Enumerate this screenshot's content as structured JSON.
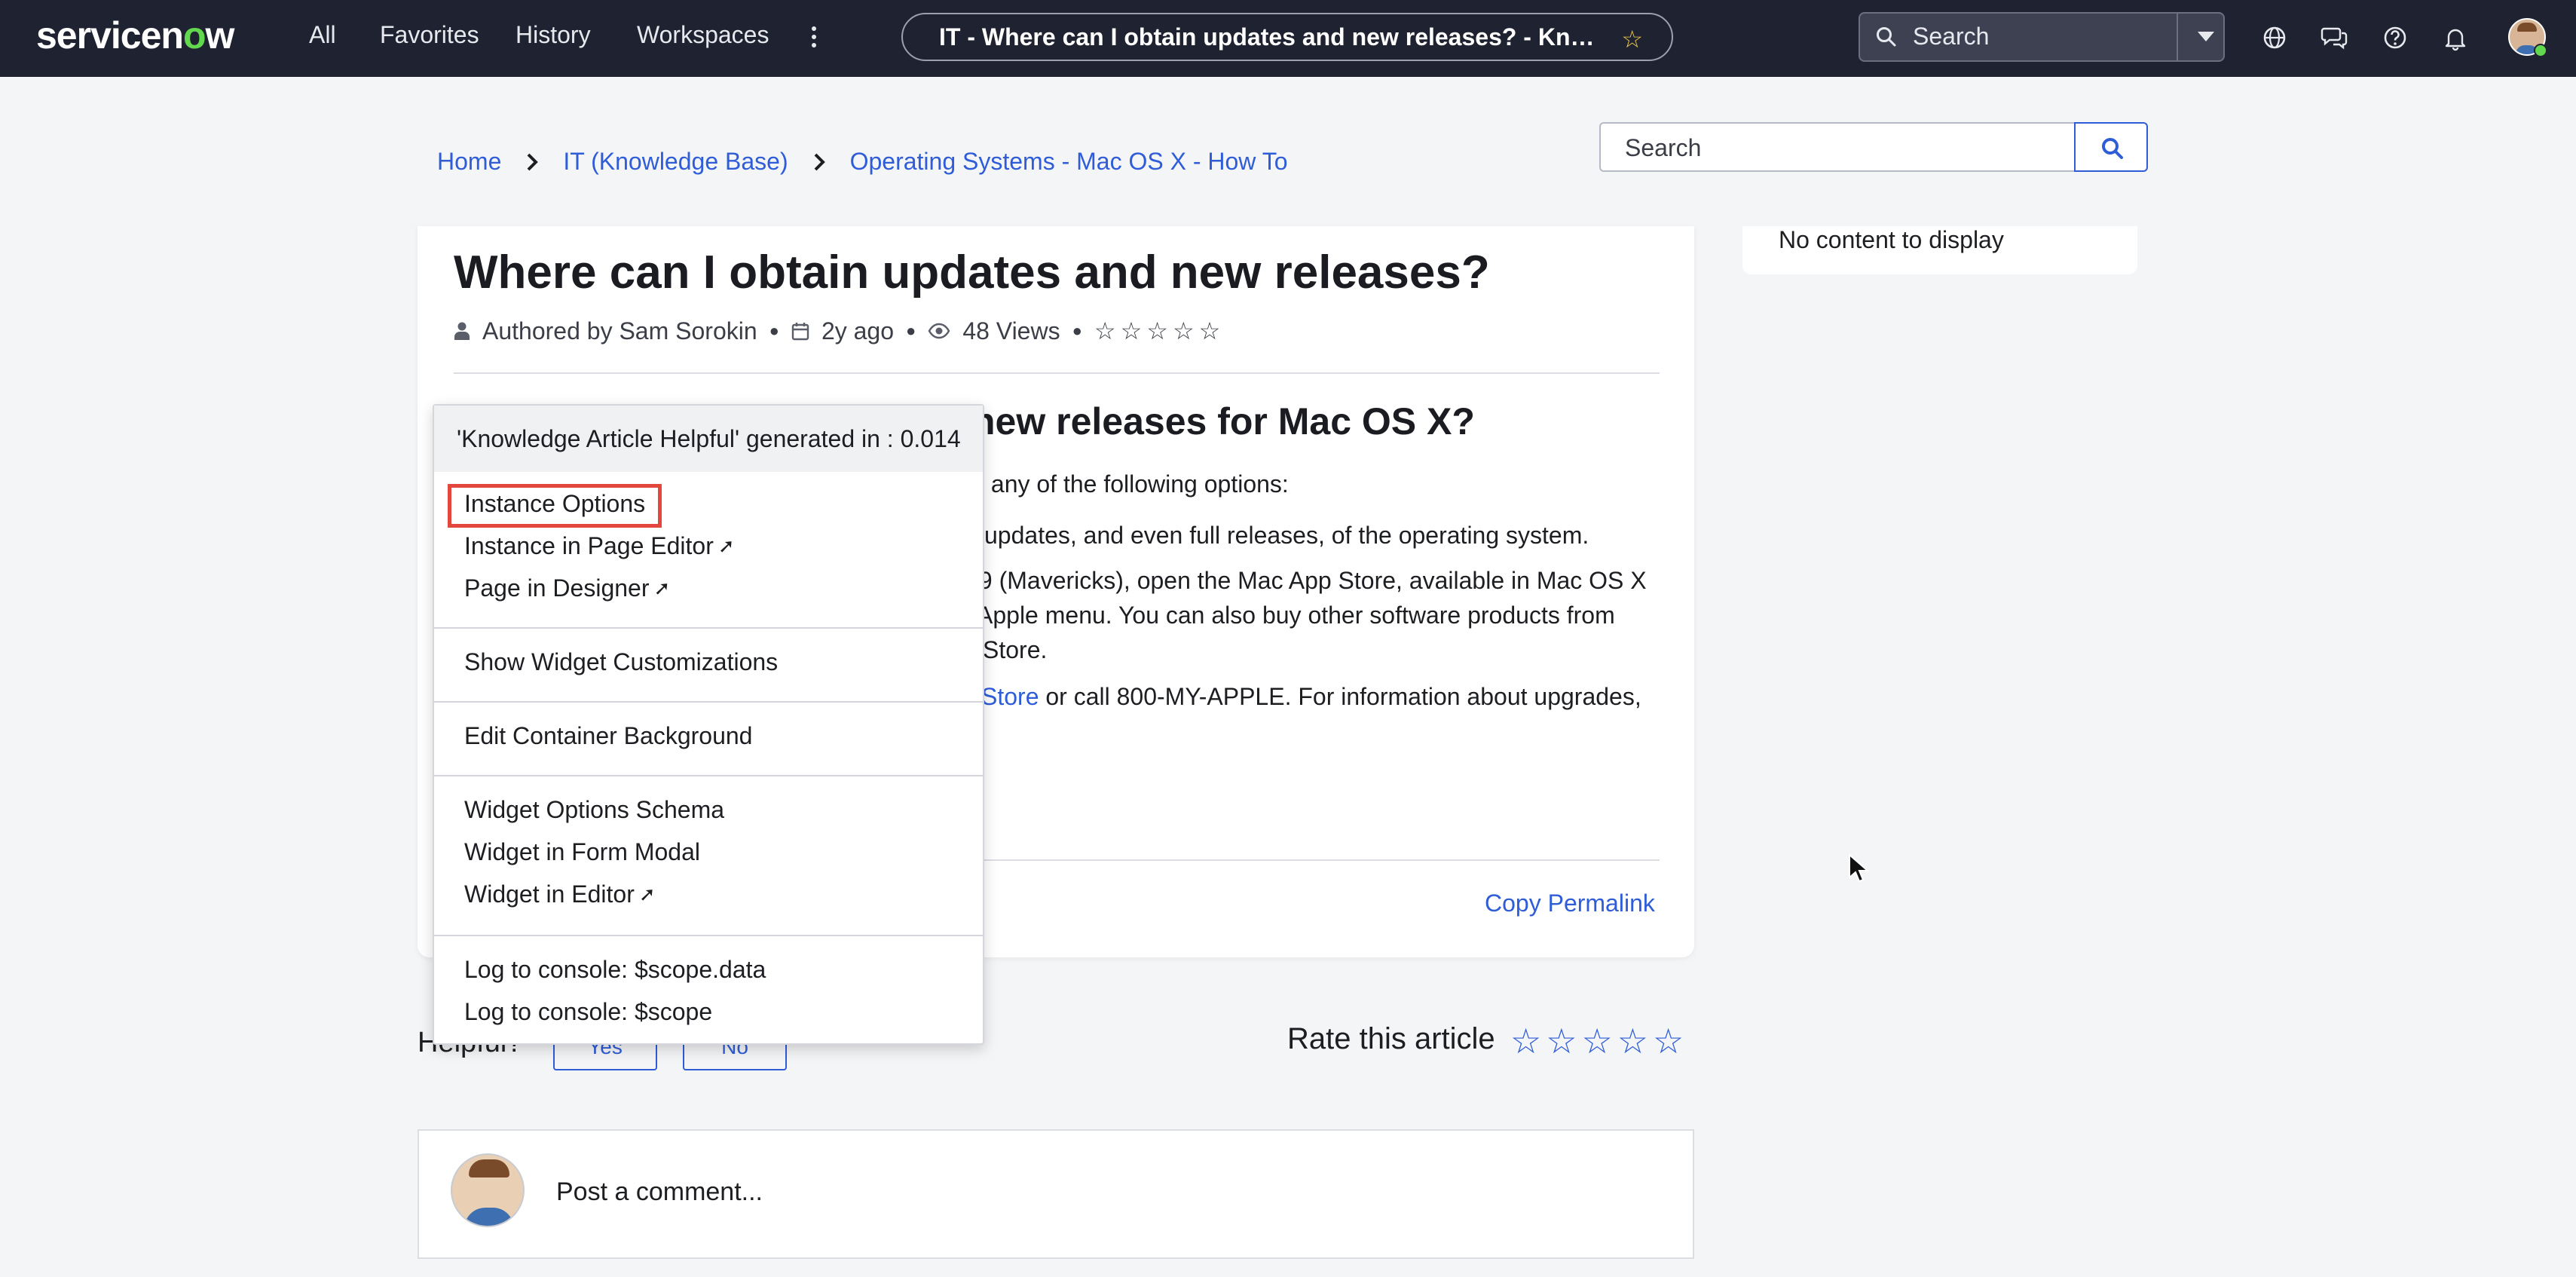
{
  "topnav": {
    "logo_text": "servicenow",
    "links": [
      "All",
      "Favorites",
      "History",
      "Workspaces"
    ],
    "page_title": "IT - Where can I obtain updates and new releases? - Knowledge Base",
    "search_placeholder": "Search"
  },
  "breadcrumb": [
    "Home",
    "IT (Knowledge Base)",
    "Operating Systems - Mac OS X - How To"
  ],
  "kb_search_placeholder": "Search",
  "sidebar": {
    "empty_text": "No content to display"
  },
  "article": {
    "title": "Where can I obtain updates and new releases?",
    "author": "Authored by Sam Sorokin",
    "age": "2y ago",
    "views": "48 Views",
    "rating_stars": "☆☆☆☆☆",
    "heading_visible": "new releases for Mac OS X?",
    "para1_visible": "y any of the following options:",
    "para2_visible": "l updates, and even full releases, of the operating system.",
    "para3_line1": ".9 (Mavericks), open the Mac App Store, available in Mac OS X",
    "para3_line2": "Apple menu. You can also buy other software products from",
    "para3_line3": "Store.",
    "para4_link": "Store",
    "para4_text": " or call 800-MY-APPLE. For information about upgrades,",
    "copy_permalink": "Copy Permalink"
  },
  "feedback": {
    "helpful_label": "Helpful?",
    "yes": "Yes",
    "no": "No",
    "rate_label": "Rate this article",
    "rate_stars": "☆☆☆☆☆"
  },
  "comment": {
    "placeholder": "Post a comment..."
  },
  "context_menu": {
    "header": "'Knowledge Article Helpful' generated in : 0.014",
    "items": [
      "Instance Options",
      "Instance in Page Editor",
      "Page in Designer",
      "Show Widget Customizations",
      "Edit Container Background",
      "Widget Options Schema",
      "Widget in Form Modal",
      "Widget in Editor",
      "Log to console: $scope.data",
      "Log to console: $scope"
    ],
    "highlighted_item": "Instance Options",
    "highlight_color": "#e2463d"
  },
  "colors": {
    "nav_bg": "#1f2230",
    "link": "#2f5dd8",
    "accent_green": "#62d84e"
  }
}
